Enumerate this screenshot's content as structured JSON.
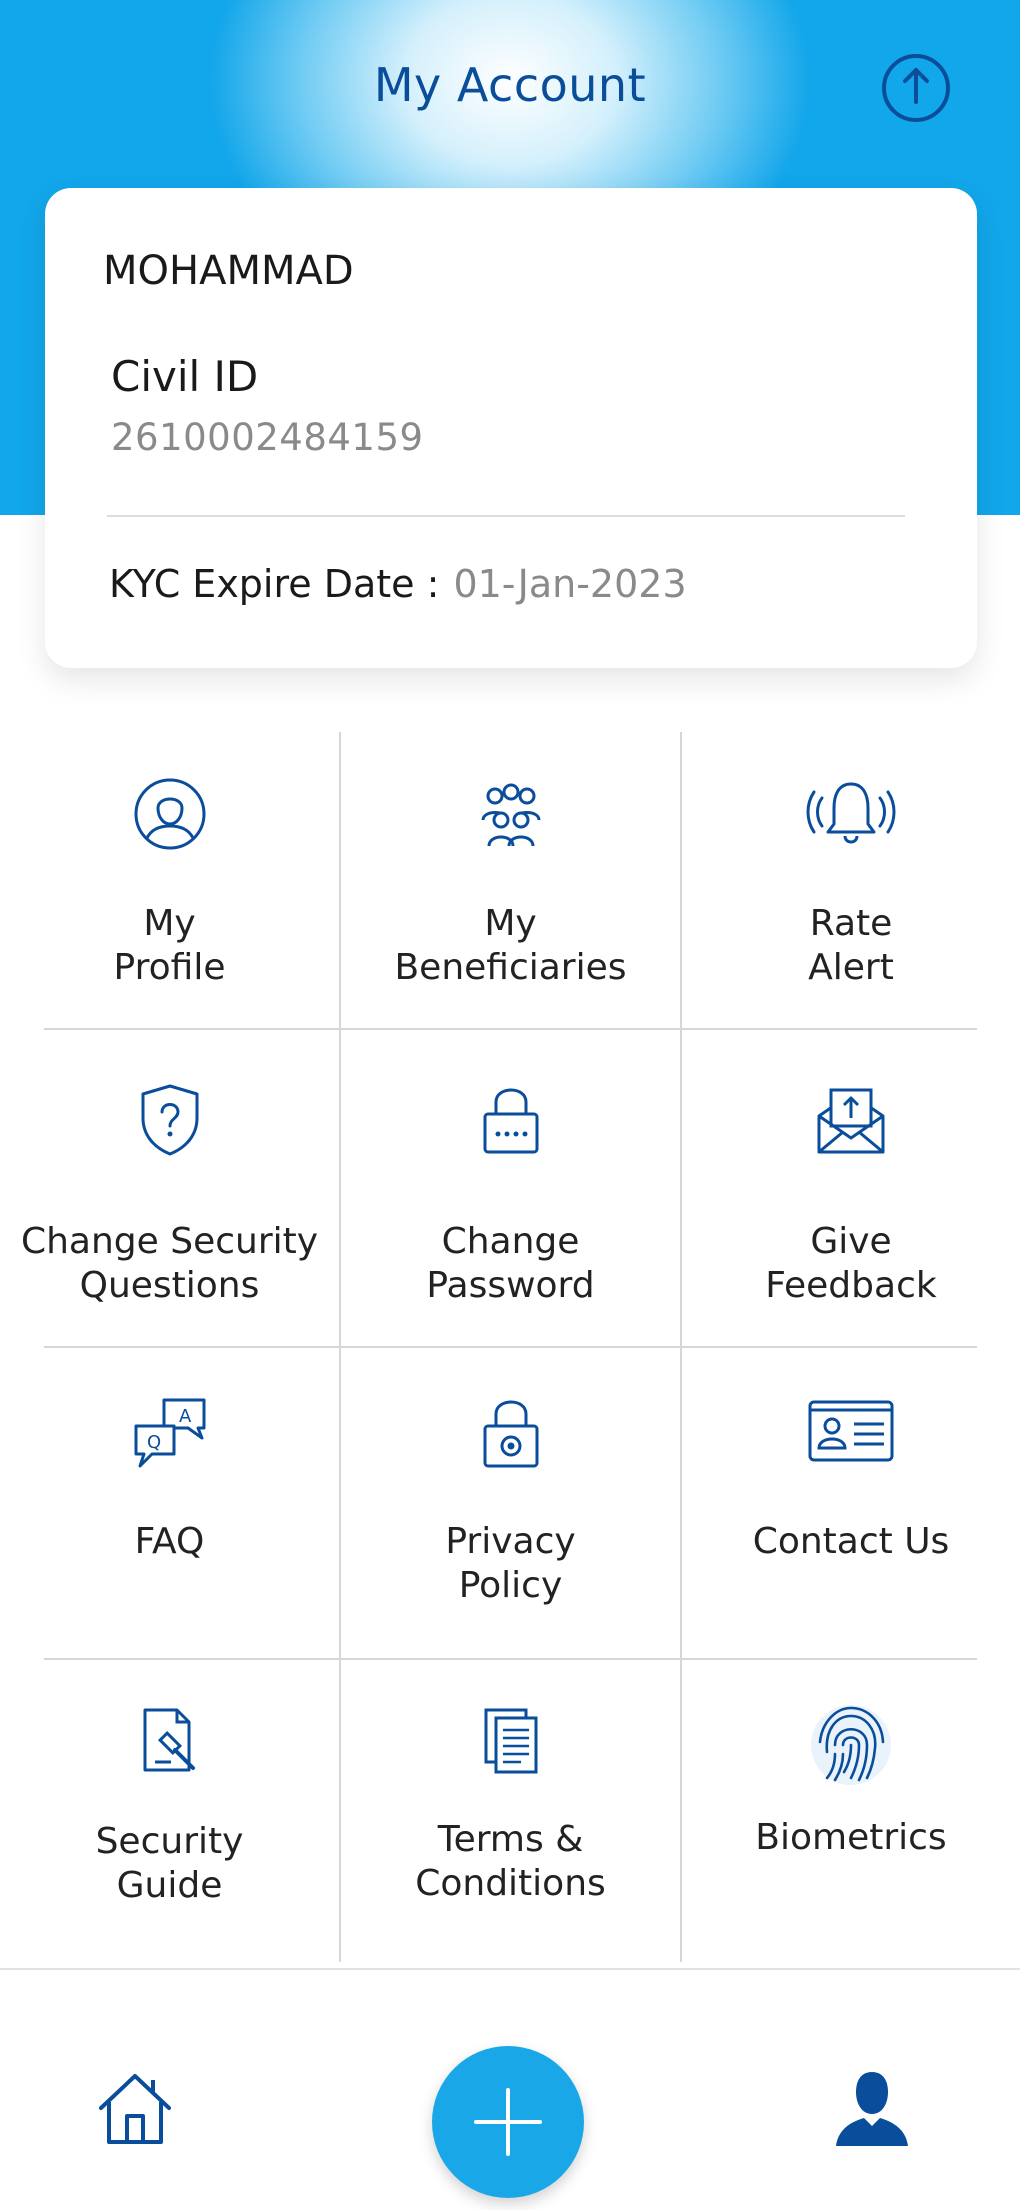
{
  "header": {
    "title": "My Account",
    "logout_icon": "power-upload-icon"
  },
  "account": {
    "name": "MOHAMMAD",
    "civil_id_label": "Civil ID",
    "civil_id_value": "2610002484159",
    "kyc_label": "KYC Expire Date :",
    "kyc_value": "01-Jan-2023"
  },
  "menu": {
    "items": [
      {
        "label": "My\nProfile",
        "icon": "user-profile-icon"
      },
      {
        "label": "My\nBeneficiaries",
        "icon": "group-icon"
      },
      {
        "label": "Rate\nAlert",
        "icon": "bell-ring-icon"
      },
      {
        "label": "Change Security\nQuestions",
        "icon": "shield-question-icon"
      },
      {
        "label": "Change\nPassword",
        "icon": "lock-password-icon"
      },
      {
        "label": "Give\nFeedback",
        "icon": "envelope-upload-icon"
      },
      {
        "label": "FAQ",
        "icon": "qa-chat-icon"
      },
      {
        "label": "Privacy\nPolicy",
        "icon": "lock-eye-icon"
      },
      {
        "label": "Contact Us",
        "icon": "contact-card-icon"
      },
      {
        "label": "Security\nGuide",
        "icon": "document-gavel-icon"
      },
      {
        "label": "Terms &\nConditions",
        "icon": "documents-icon"
      },
      {
        "label": "Biometrics",
        "icon": "fingerprint-icon"
      }
    ]
  },
  "bottom_nav": {
    "home_icon": "home-icon",
    "add_icon": "plus-icon",
    "profile_icon": "person-icon"
  },
  "colors": {
    "brand_blue": "#0a4d9a",
    "sky_blue": "#12a6ea",
    "fab_blue": "#1aa7e8"
  }
}
